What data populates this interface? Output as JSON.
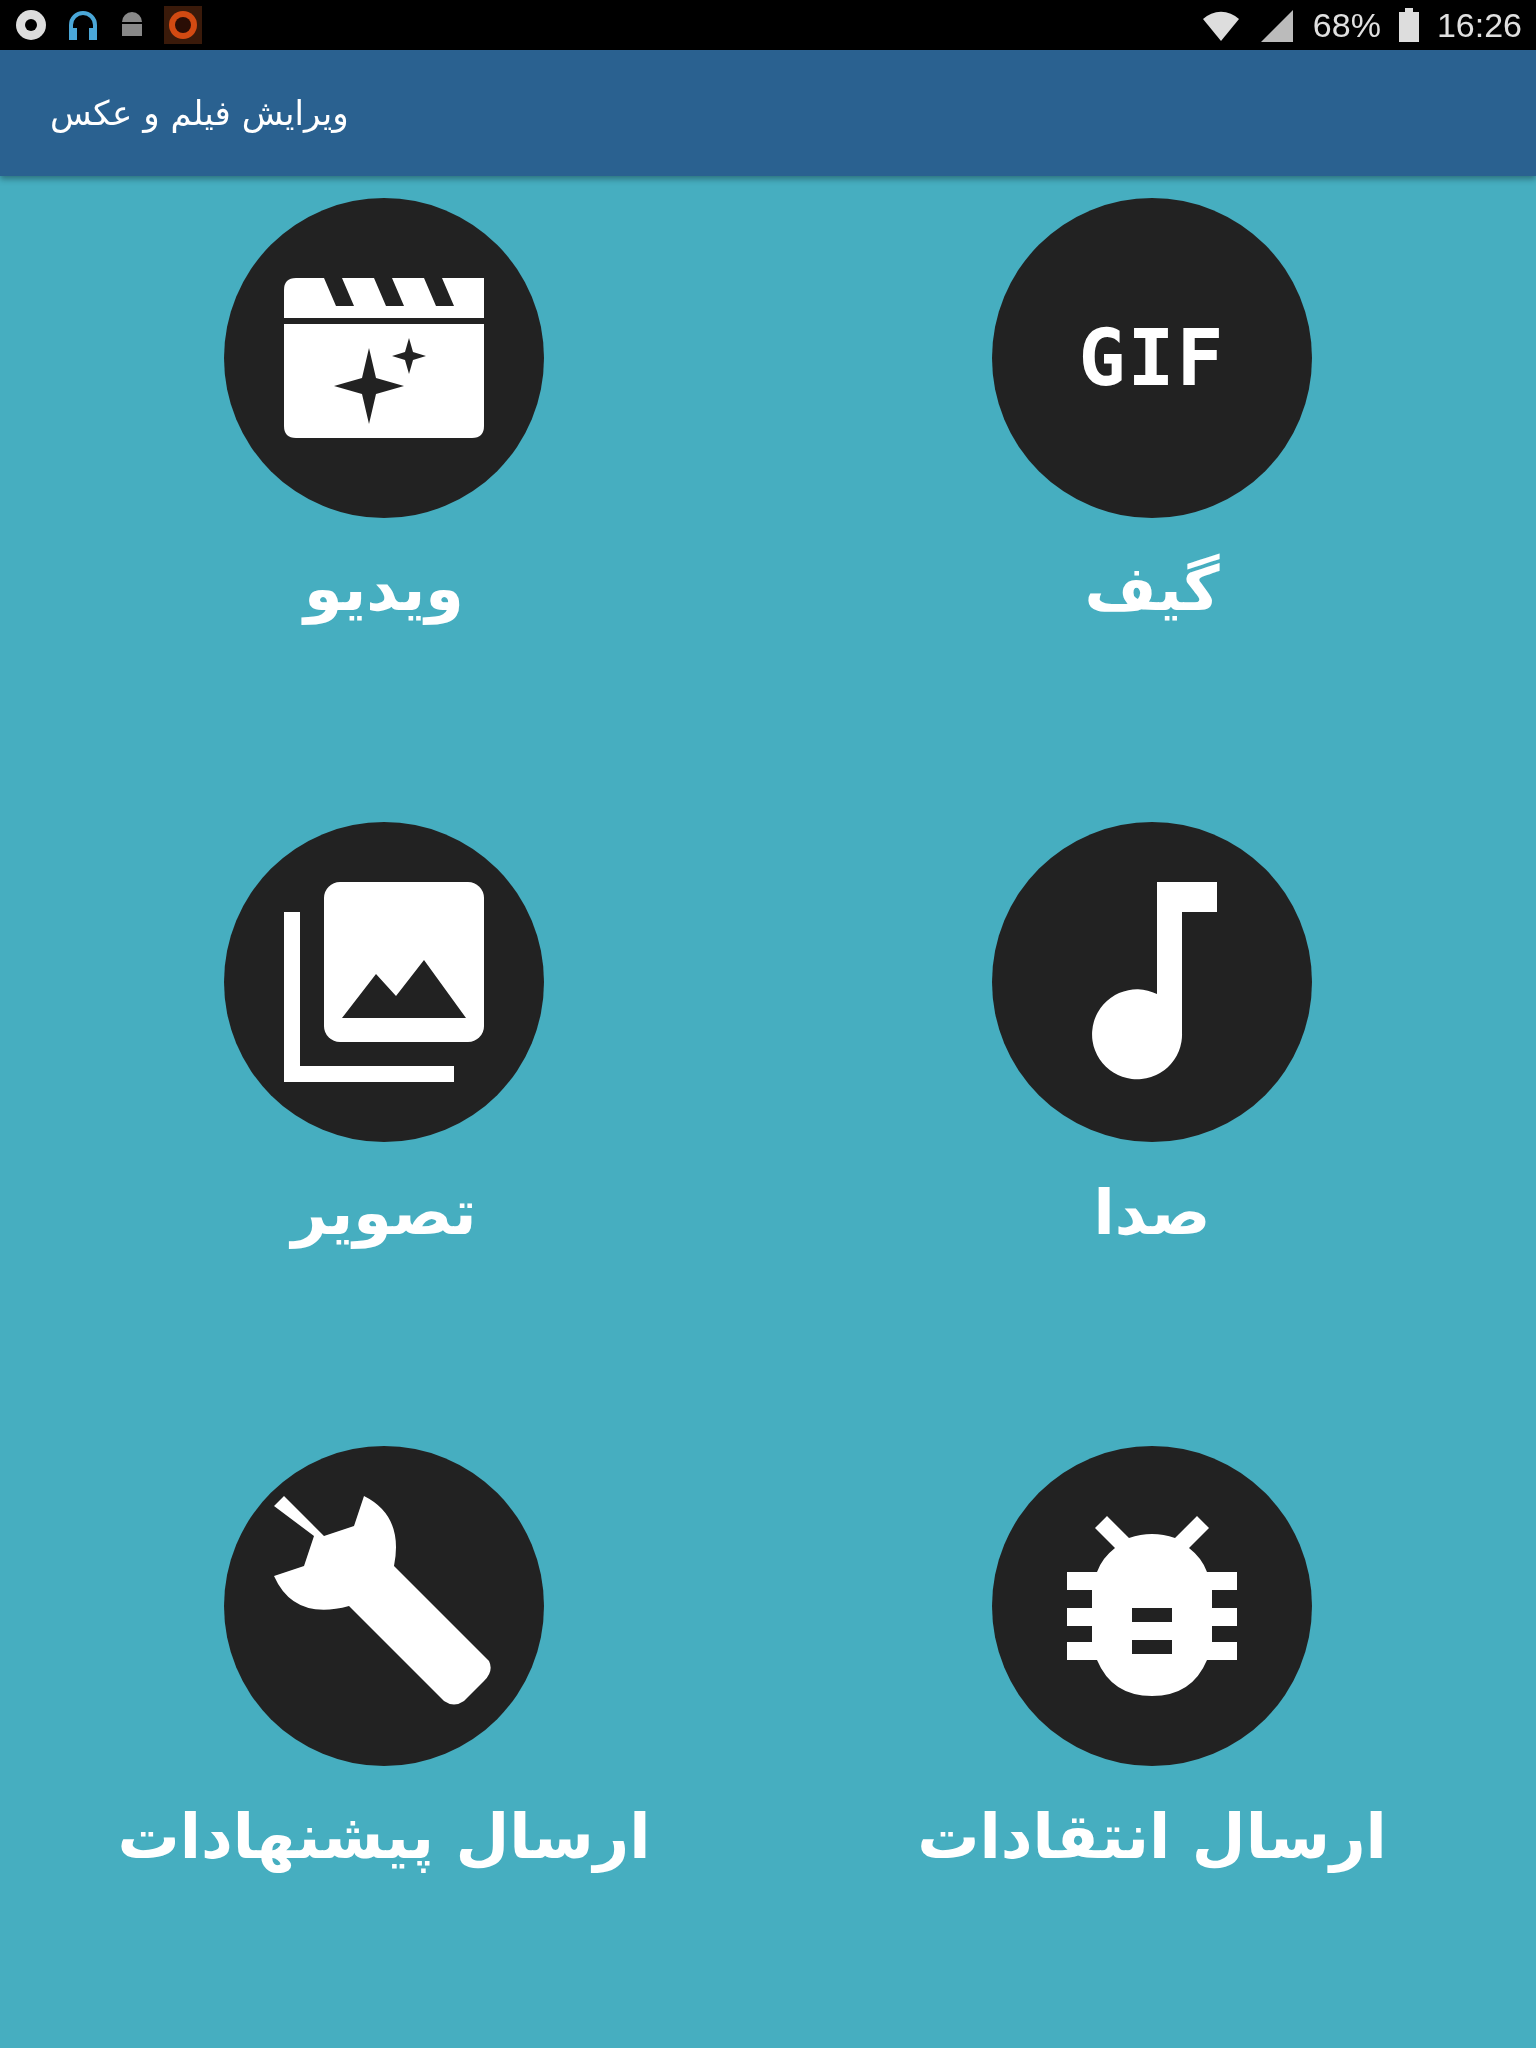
{
  "status_bar": {
    "battery": "68%",
    "time": "16:26"
  },
  "app_bar": {
    "title": "ویرایش فیلم و عکس"
  },
  "menu": [
    {
      "kind": "gif",
      "label": "گیف",
      "icon_text": "GIF"
    },
    {
      "kind": "video",
      "label": "ویدیو"
    },
    {
      "kind": "audio",
      "label": "صدا"
    },
    {
      "kind": "image",
      "label": "تصویر"
    },
    {
      "kind": "bug",
      "label": "ارسال انتقادات"
    },
    {
      "kind": "wrench",
      "label": "ارسال پیشنهادات"
    }
  ]
}
